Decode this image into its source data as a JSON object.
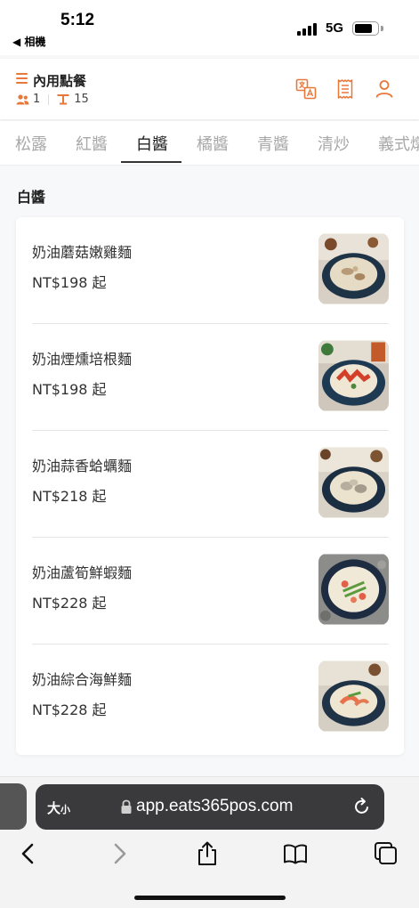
{
  "status_bar": {
    "time": "5:12",
    "back_label": "◀ 相機",
    "network": "5G"
  },
  "header": {
    "title": "內用點餐",
    "guests": "1",
    "table": "15"
  },
  "tabs": [
    "松露",
    "紅醬",
    "白醬",
    "橘醬",
    "青醬",
    "清炒",
    "義式燉"
  ],
  "active_tab": "白醬",
  "section": {
    "title": "白醬"
  },
  "items": [
    {
      "name": "奶油蘑菇嫩雞麵",
      "price": "NT$198 起"
    },
    {
      "name": "奶油煙燻培根麵",
      "price": "NT$198 起"
    },
    {
      "name": "奶油蒜香蛤蠣麵",
      "price": "NT$218 起"
    },
    {
      "name": "奶油蘆筍鮮蝦麵",
      "price": "NT$228 起"
    },
    {
      "name": "奶油綜合海鮮麵",
      "price": "NT$228 起"
    }
  ],
  "browser": {
    "size_label": "大",
    "size_small": "小",
    "url": "app.eats365pos.com"
  },
  "colors": {
    "accent": "#e8783a",
    "text": "#222222",
    "muted": "#a8a8a8"
  }
}
